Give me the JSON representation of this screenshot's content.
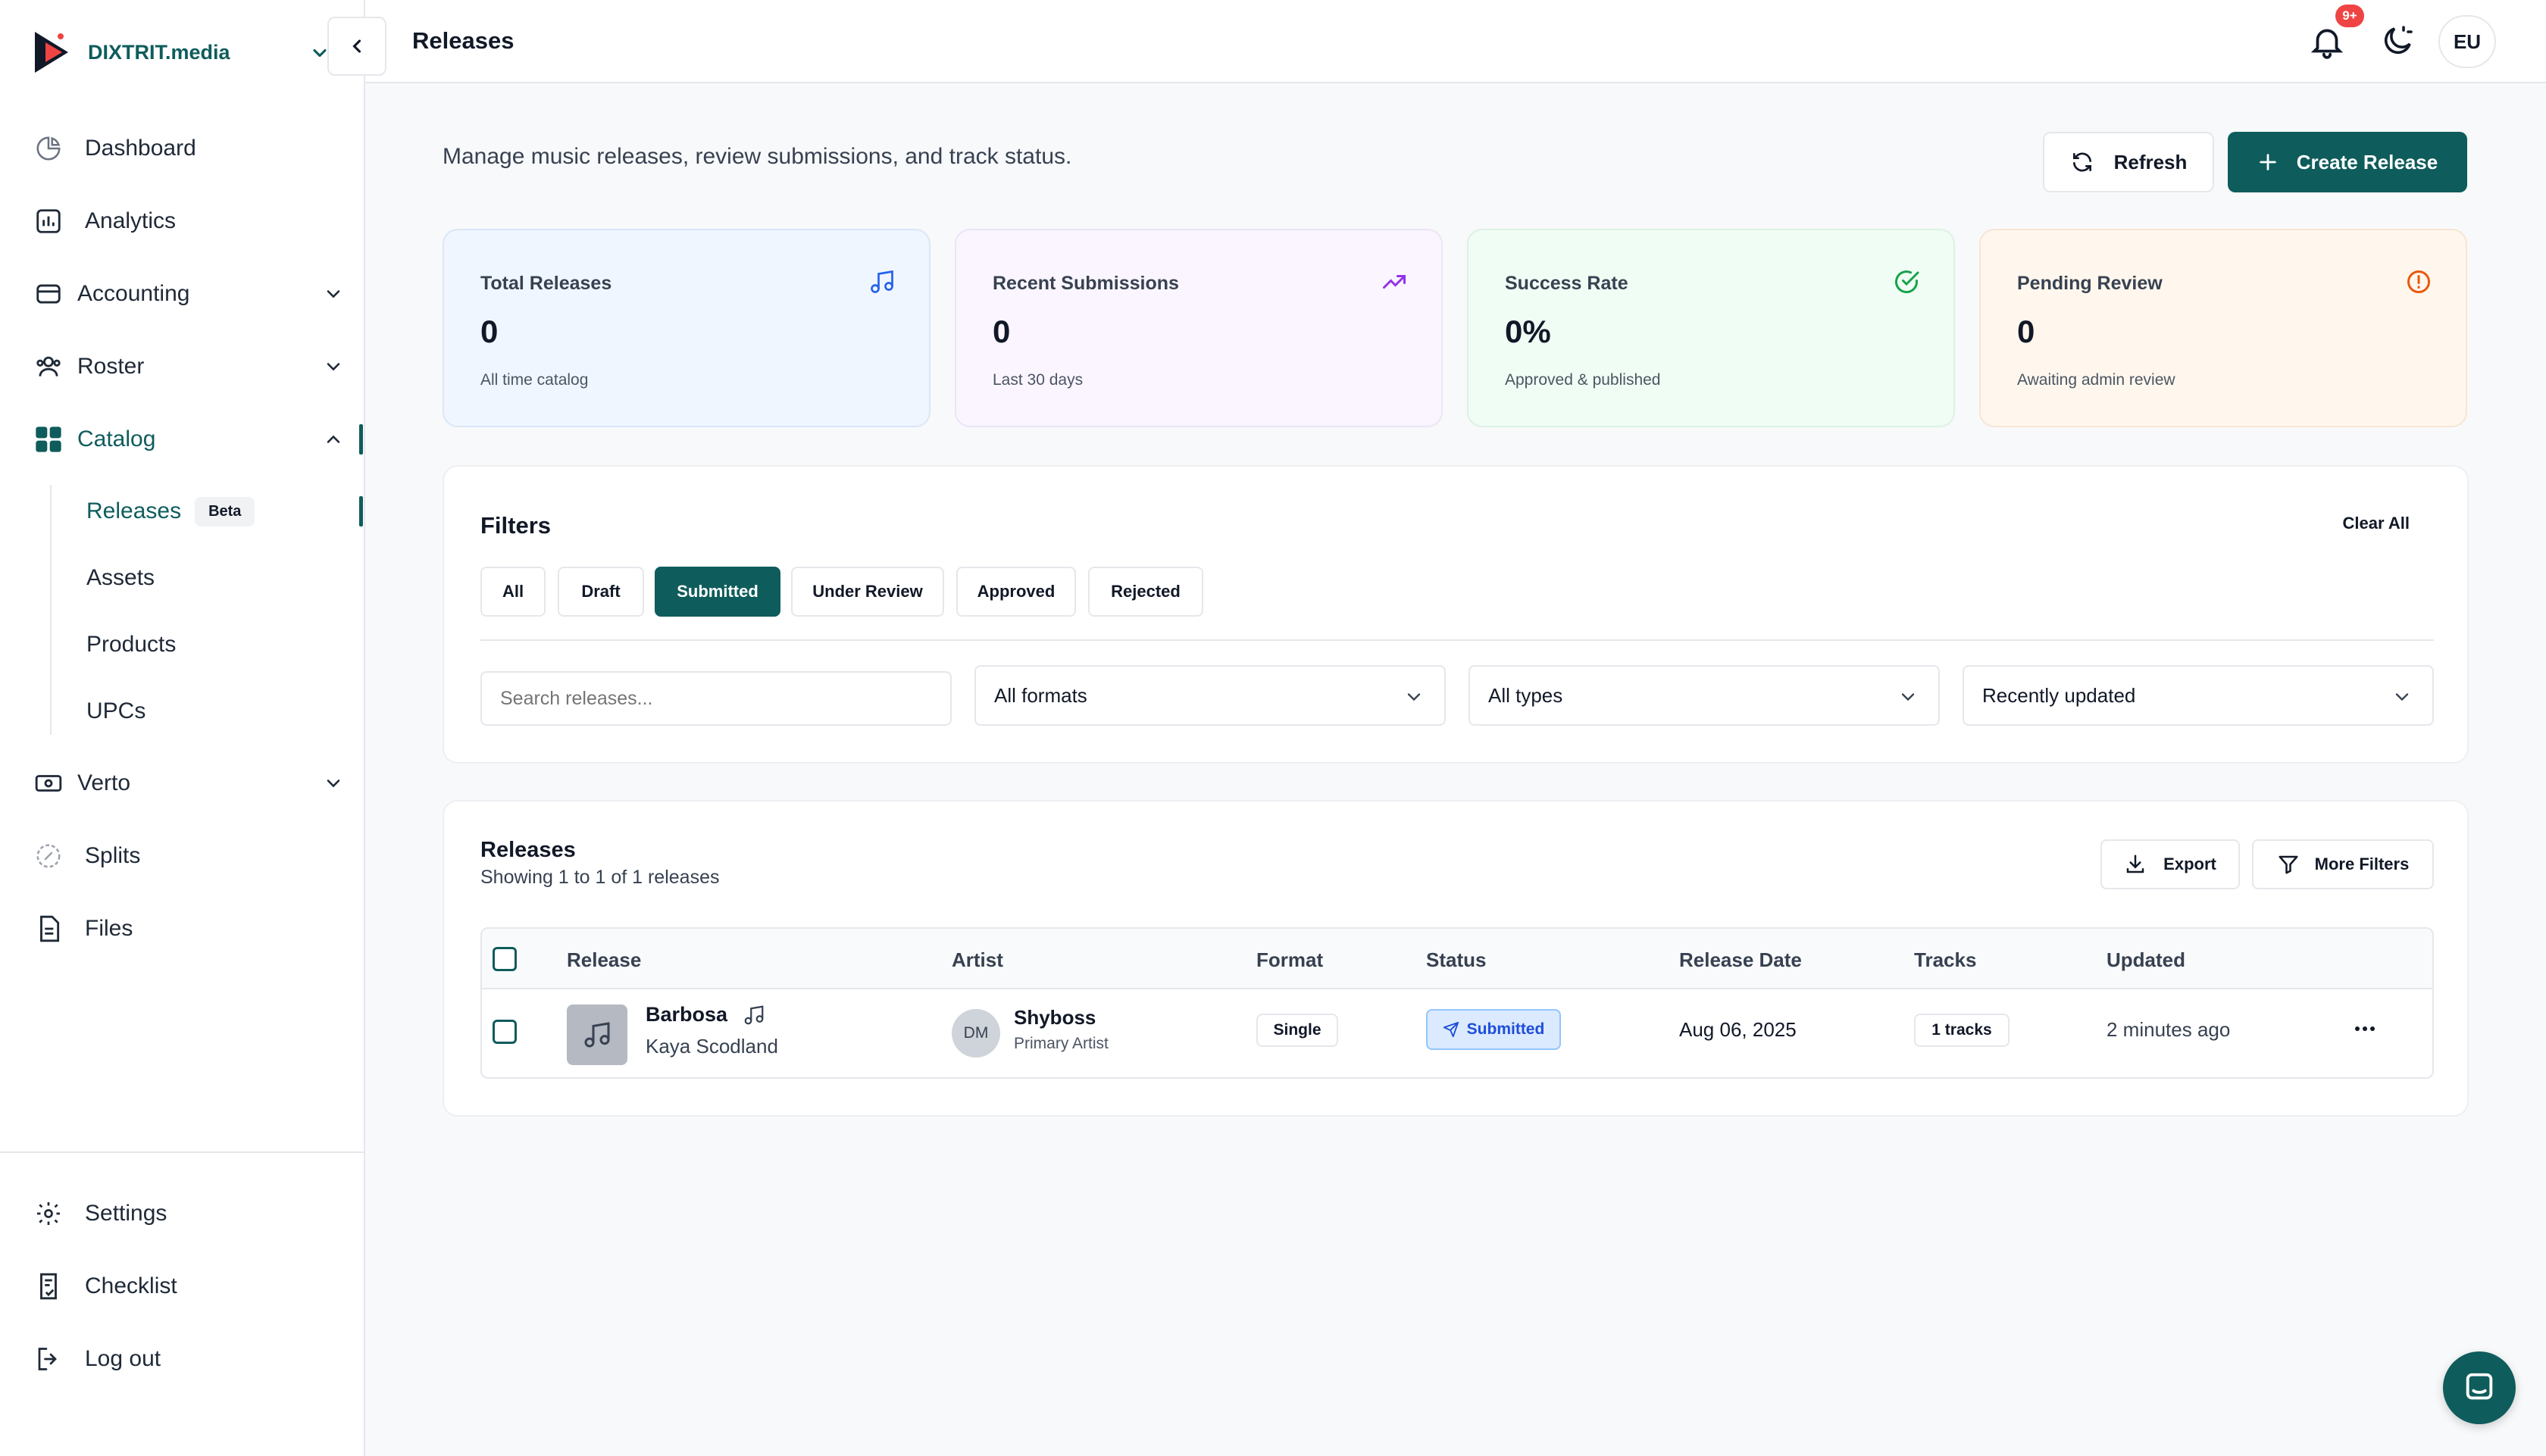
{
  "brand": {
    "name": "DIXTRIT.media"
  },
  "colors": {
    "primary": "#0f5c5c",
    "danger": "#ef4444",
    "status_blue": "#1d4ed8"
  },
  "sidebar": {
    "items": [
      {
        "label": "Dashboard",
        "icon": "dashboard-icon"
      },
      {
        "label": "Analytics",
        "icon": "analytics-icon"
      },
      {
        "label": "Accounting",
        "icon": "accounting-icon",
        "expandable": true
      },
      {
        "label": "Roster",
        "icon": "roster-icon",
        "expandable": true
      },
      {
        "label": "Catalog",
        "icon": "catalog-icon",
        "expandable": true,
        "expanded": true
      },
      {
        "label": "Verto",
        "icon": "verto-icon",
        "expandable": true
      },
      {
        "label": "Splits",
        "icon": "splits-icon"
      },
      {
        "label": "Files",
        "icon": "files-icon"
      }
    ],
    "catalog_sub": [
      {
        "label": "Releases",
        "badge": "Beta",
        "active": true
      },
      {
        "label": "Assets"
      },
      {
        "label": "Products"
      },
      {
        "label": "UPCs"
      }
    ],
    "bottom": [
      {
        "label": "Settings",
        "icon": "settings-icon"
      },
      {
        "label": "Checklist",
        "icon": "checklist-icon"
      },
      {
        "label": "Log out",
        "icon": "logout-icon"
      }
    ]
  },
  "topbar": {
    "title": "Releases",
    "notif_badge": "9+",
    "user_initials": "EU"
  },
  "main": {
    "description": "Manage music releases, review submissions, and track status.",
    "refresh_label": "Refresh",
    "create_label": "Create Release",
    "stats": [
      {
        "label": "Total Releases",
        "value": "0",
        "sub": "All time catalog",
        "icon": "music-note-icon",
        "color": "#2563eb"
      },
      {
        "label": "Recent Submissions",
        "value": "0",
        "sub": "Last 30 days",
        "icon": "trending-up-icon",
        "color": "#9333ea"
      },
      {
        "label": "Success Rate",
        "value": "0%",
        "sub": "Approved & published",
        "icon": "check-circle-icon",
        "color": "#16a34a"
      },
      {
        "label": "Pending Review",
        "value": "0",
        "sub": "Awaiting admin review",
        "icon": "alert-circle-icon",
        "color": "#ea580c"
      }
    ],
    "filters": {
      "title": "Filters",
      "clear_all": "Clear All",
      "chips": [
        "All",
        "Draft",
        "Submitted",
        "Under Review",
        "Approved",
        "Rejected"
      ],
      "active_chip": "Submitted",
      "search_placeholder": "Search releases...",
      "format_select": "All formats",
      "type_select": "All types",
      "sort_select": "Recently updated"
    },
    "releases": {
      "title": "Releases",
      "subtitle": "Showing 1 to 1 of 1 releases",
      "export_label": "Export",
      "more_filters_label": "More Filters",
      "columns": [
        "Release",
        "Artist",
        "Format",
        "Status",
        "Release Date",
        "Tracks",
        "Updated"
      ],
      "rows": [
        {
          "release": "Barbosa",
          "release_artist": "Kaya Scodland",
          "artist_initials": "DM",
          "artist": "Shyboss",
          "artist_role": "Primary Artist",
          "format": "Single",
          "status": "Submitted",
          "release_date": "Aug 06, 2025",
          "tracks": "1 tracks",
          "updated": "2 minutes ago"
        }
      ]
    }
  }
}
